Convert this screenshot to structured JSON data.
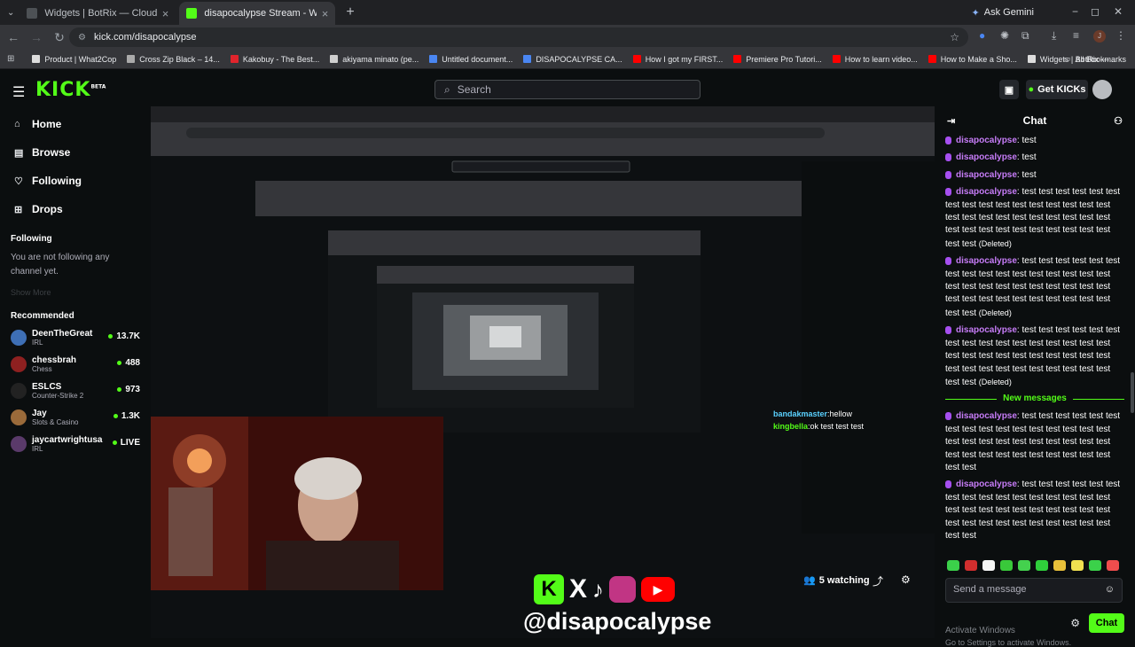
{
  "browser": {
    "tabs": [
      {
        "title": "Widgets | BotRix — Cloud Strea",
        "active": false,
        "fav": "#4d5155"
      },
      {
        "title": "disapocalypse Stream - Wa",
        "active": true,
        "fav": "#53fc18"
      }
    ],
    "new_tab": "+",
    "ask_gemini": "Ask Gemini",
    "minimize": "−",
    "maximize": "◻",
    "close": "✕",
    "url": "kick.com/disapocalypse",
    "bookmarks": [
      {
        "label": "Product | What2Cop",
        "color": "#dddddd"
      },
      {
        "label": "Cross Zip Black – 14...",
        "color": "#aaaaaa"
      },
      {
        "label": "Kakobuy - The Best...",
        "color": "#e0242c"
      },
      {
        "label": "akiyama minato (pe...",
        "color": "#cfcfcf"
      },
      {
        "label": "Untitled document...",
        "color": "#4a86f2"
      },
      {
        "label": "DISAPOCALYPSE CA...",
        "color": "#4a86f2"
      },
      {
        "label": "How I got my FIRST...",
        "color": "#ff0000"
      },
      {
        "label": "Premiere Pro Tutori...",
        "color": "#ff0000"
      },
      {
        "label": "How to learn video...",
        "color": "#ff0000"
      },
      {
        "label": "How to Make a Sho...",
        "color": "#ff0000"
      },
      {
        "label": "Widgets | BotRix —...",
        "color": "#dddddd"
      }
    ],
    "all_bookmarks": "All Bookmarks"
  },
  "kick": {
    "logo": "KICK",
    "beta": "BETA",
    "search_placeholder": "Search",
    "get_kicks": "Get KICKs",
    "nav": [
      {
        "label": "Home",
        "icon": "⌂"
      },
      {
        "label": "Browse",
        "icon": "▤"
      },
      {
        "label": "Following",
        "icon": "♡"
      },
      {
        "label": "Drops",
        "icon": "⊞"
      }
    ],
    "following_title": "Following",
    "following_msg": "You are not following any channel yet.",
    "show_more": "Show More",
    "recommended_title": "Recommended",
    "recommended": [
      {
        "name": "DeenTheGreat",
        "category": "IRL",
        "viewers": "13.7K",
        "color": "#3e6fb5"
      },
      {
        "name": "chessbrah",
        "category": "Chess",
        "viewers": "488",
        "color": "#8e2020"
      },
      {
        "name": "ESLCS",
        "category": "Counter-Strike 2",
        "viewers": "973",
        "color": "#222222"
      },
      {
        "name": "Jay",
        "category": "Slots & Casino",
        "viewers": "1.3K",
        "color": "#9a6a3a"
      },
      {
        "name": "jaycartwrightusa",
        "category": "IRL",
        "viewers": "LIVE",
        "color": "#5a3a6a"
      }
    ]
  },
  "stream": {
    "handle": "@disapocalypse",
    "watching": "5 watching",
    "social_letters": "K X"
  },
  "chat": {
    "title": "Chat",
    "new_messages": "New messages",
    "messages_top": [
      {
        "user": "disapocalypse",
        "text": "test",
        "deleted": ""
      },
      {
        "user": "disapocalypse",
        "text": "test",
        "deleted": ""
      },
      {
        "user": "disapocalypse",
        "text": "test",
        "deleted": ""
      },
      {
        "user": "disapocalypse",
        "text": "test test test test test test test test test test test test test test test test test test test test test test test test test test test test test test test test test test test test test test",
        "deleted": "(Deleted)"
      },
      {
        "user": "disapocalypse",
        "text": "test test test test test test test test test test test test test test test test test test test test test test test test test test test test test test test test test test test test test test",
        "deleted": "(Deleted)"
      },
      {
        "user": "disapocalypse",
        "text": "test test test test test test test test test test test test test test test test test test test test test test test test test test test test test test test test test test test test test test",
        "deleted": "(Deleted)"
      }
    ],
    "messages_new": [
      {
        "user": "disapocalypse",
        "text": "test test test test test test test test test test test test test test test test test test test test test test test test test test test test test test test test test test test test test test"
      },
      {
        "user": "disapocalypse",
        "text": "test test test test test test test test test test test test test test test test test test test test test test test test test test test test test test test test test test test test test test"
      }
    ],
    "input_placeholder": "Send a message",
    "activate_1": "Activate Windows",
    "activate_2": "Go to Settings to activate Windows.",
    "send": "Chat",
    "emote_colors": [
      "#3bd14a",
      "#d12e2e",
      "#f5f5f5",
      "#39c93a",
      "#44d14e",
      "#2fcf3b",
      "#e8c03a",
      "#f0e050",
      "#3bd14a",
      "#f04d4d"
    ]
  },
  "overlay_chat": [
    {
      "user": "bandakmaster",
      "text": "hellow"
    },
    {
      "user": "kingbella",
      "text": "ok test test test"
    }
  ]
}
